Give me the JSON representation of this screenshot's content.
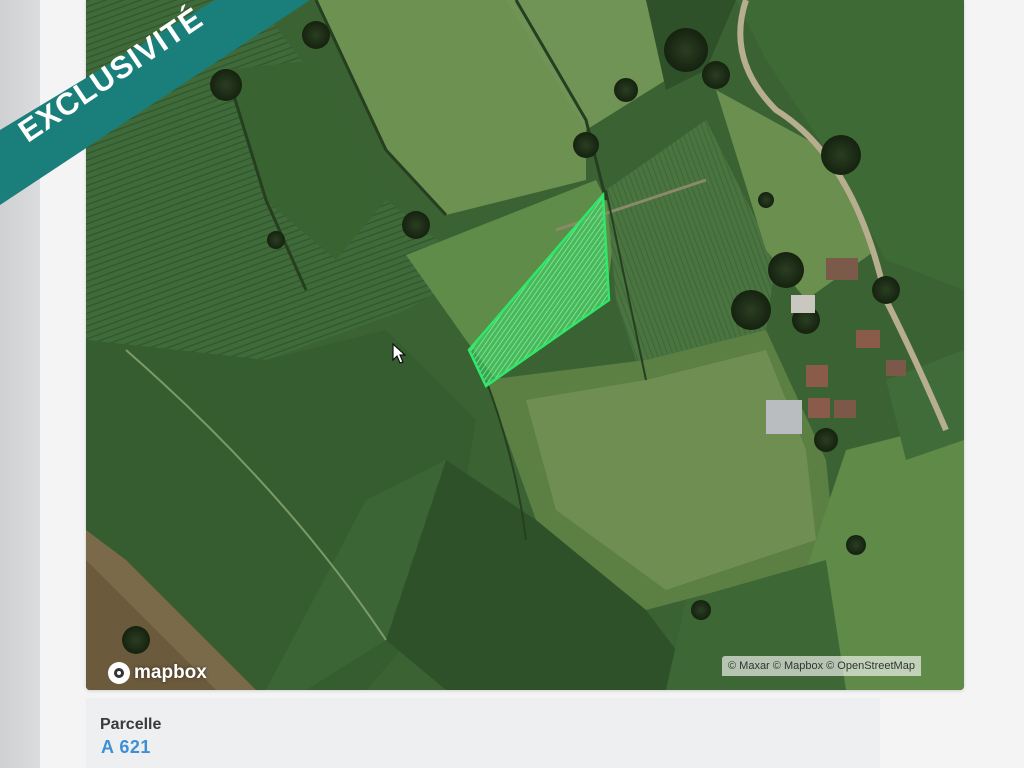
{
  "map": {
    "attribution": "© Maxar © Mapbox © OpenStreetMap",
    "logo_text": "mapbox",
    "highlight_color": "#2ee86a"
  },
  "ribbon": {
    "label": "EXCLUSIVITÉ",
    "color": "#1a7f7a"
  },
  "parcel": {
    "label": "Parcelle",
    "value": "A 621"
  },
  "icons": {
    "cursor": "cursor-arrow-icon",
    "logo": "mapbox-logo-icon"
  }
}
